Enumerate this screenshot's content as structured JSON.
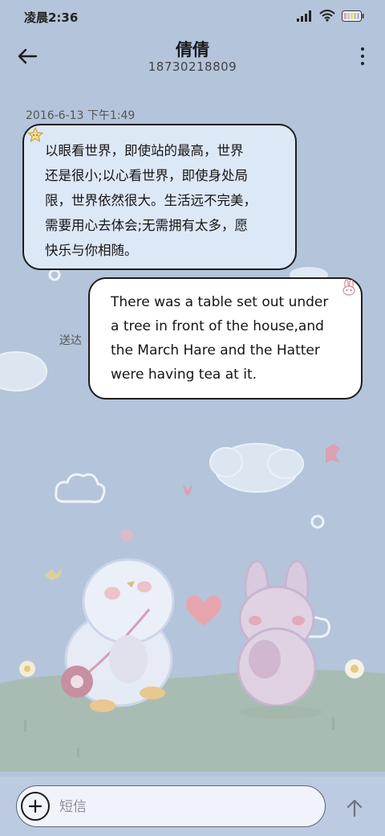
{
  "status_bar": {
    "time": "凌晨2:36"
  },
  "header": {
    "contact_name": "倩倩",
    "contact_number": "18730218809"
  },
  "messages": [
    {
      "direction": "incoming",
      "timestamp": "2016-6-13 下午1:49",
      "lines": [
        "以眼看世界，即使站的最高，世界",
        "还是很小;以心看世界，即使身处局",
        "限，世界依然很大。生活远不完美，",
        "需要用心去体会;无需拥有太多，愿",
        "快乐与你相随。"
      ]
    },
    {
      "direction": "outgoing",
      "status": "送达",
      "lines": [
        "There was a table set out under",
        "a tree in front of the house,and",
        "the March Hare and the Hatter",
        "were having tea at it."
      ]
    }
  ],
  "composer": {
    "placeholder": "短信"
  },
  "colors": {
    "background": "#b4c4da",
    "incoming_bubble": "#dde8f6",
    "outgoing_bubble": "#ffffff",
    "bubble_border": "#1d1d1d"
  },
  "icons": {
    "back": "arrow-left-icon",
    "more": "more-vertical-icon",
    "add": "plus-circle-icon",
    "send": "arrow-up-icon",
    "signal": "signal-icon",
    "wifi": "wifi-icon",
    "battery": "battery-icon"
  }
}
